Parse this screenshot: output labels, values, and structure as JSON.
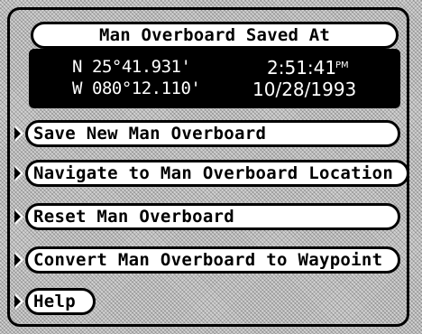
{
  "title": "Man Overboard Saved At",
  "position": {
    "lat_dir": "N",
    "lat_value": "25°41.931'",
    "lon_dir": "W",
    "lon_value": "080°12.110'"
  },
  "saved": {
    "time": "2:51:41",
    "ampm": "PM",
    "date": "10/28/1993"
  },
  "menu": [
    {
      "label": "Save New Man Overboard"
    },
    {
      "label": "Navigate to Man Overboard Location"
    },
    {
      "label": "Reset Man Overboard"
    },
    {
      "label": "Convert Man Overboard to Waypoint"
    },
    {
      "label": "Help"
    }
  ]
}
